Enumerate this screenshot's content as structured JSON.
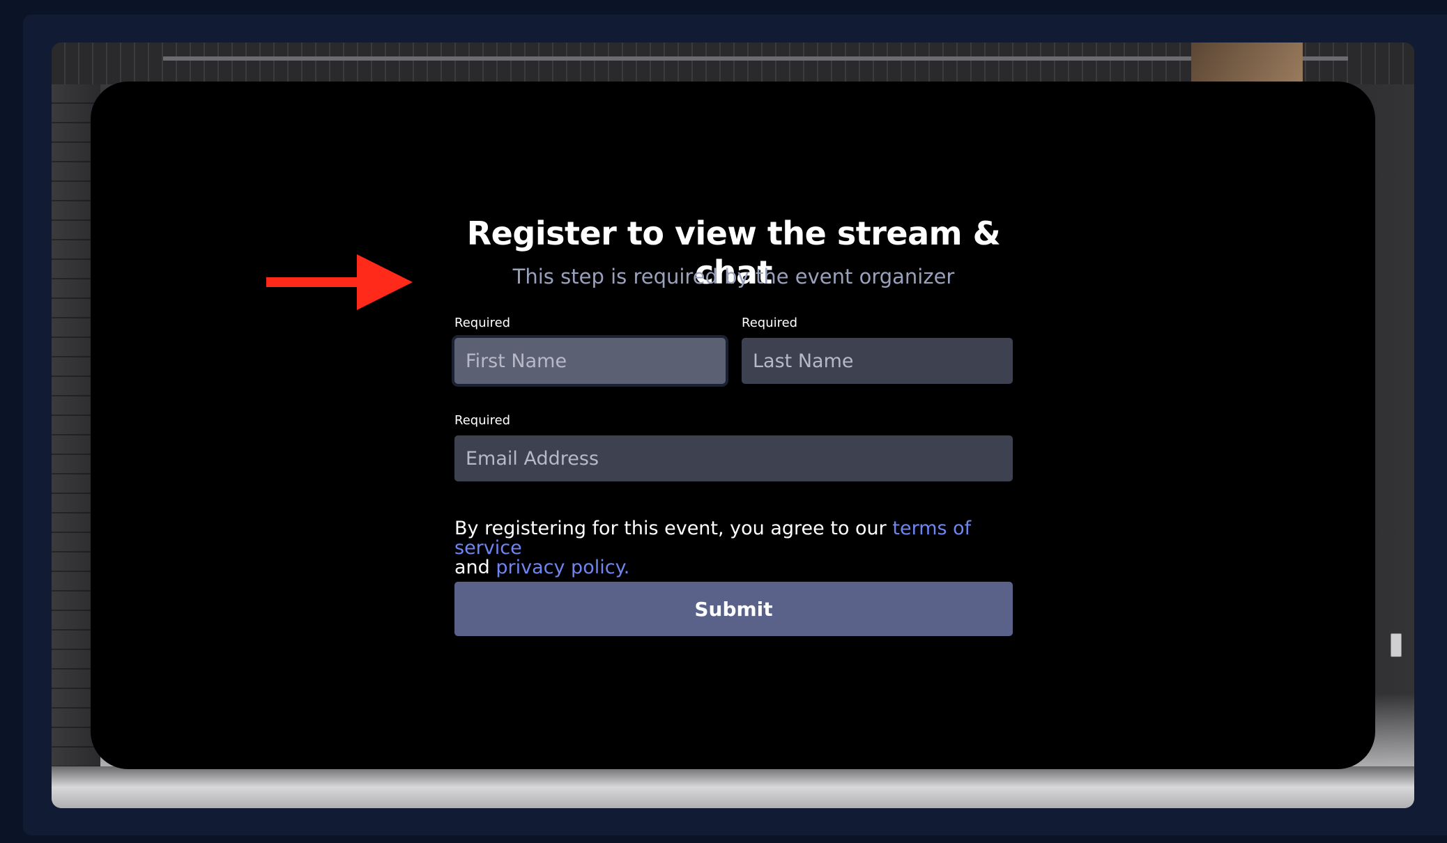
{
  "modal": {
    "title": "Register to view the stream & chat",
    "subtitle": "This step is required by the event organizer"
  },
  "form": {
    "first_name": {
      "label": "Required",
      "placeholder": "First Name"
    },
    "last_name": {
      "label": "Required",
      "placeholder": "Last Name"
    },
    "email": {
      "label": "Required",
      "placeholder": "Email Address"
    },
    "agreement": {
      "prefix": "By registering for this event, you agree to our",
      "terms_link": "terms of service",
      "middle": "and",
      "privacy_link": "privacy policy."
    },
    "submit_label": "Submit"
  },
  "colors": {
    "page_background": "#0b1326",
    "modal_background": "#000000",
    "input_background": "#3d4150",
    "focused_input_background": "#5b6072",
    "link": "#6f86f2",
    "submit_button": "#5a6289",
    "annotation_arrow": "#ff2a1a"
  },
  "icons": {
    "annotation": "red-arrow-right"
  }
}
